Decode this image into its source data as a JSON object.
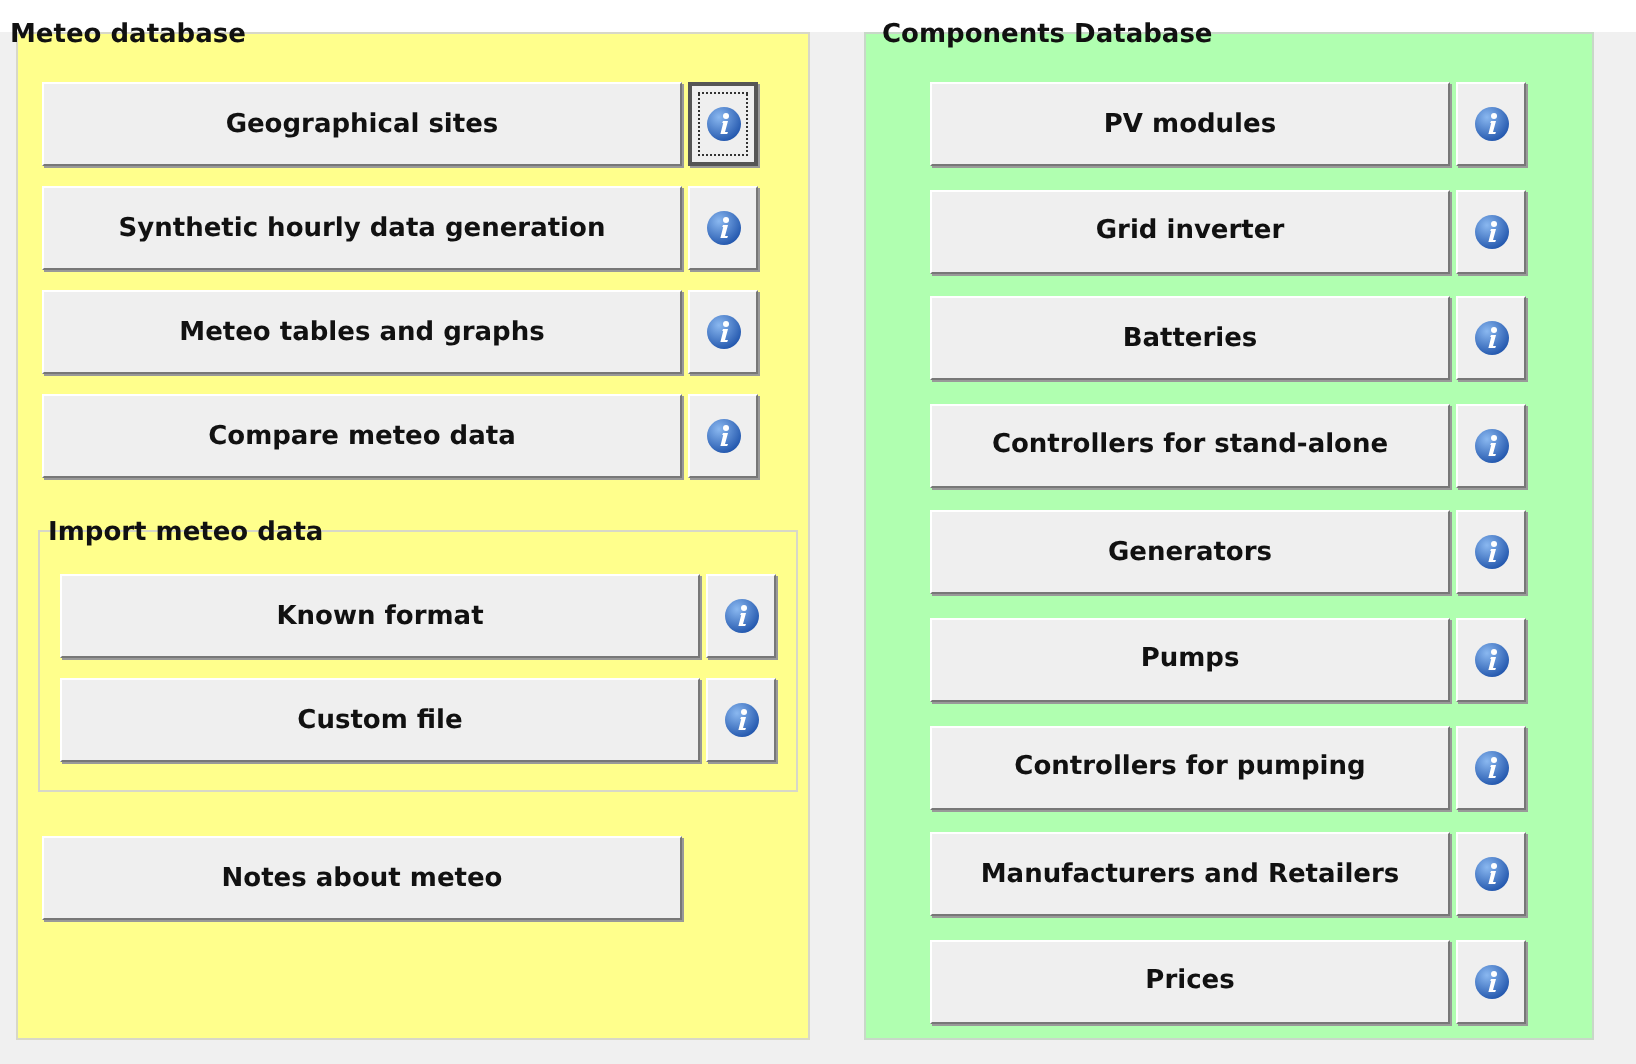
{
  "meteo_database": {
    "title": "Meteo database",
    "buttons": [
      {
        "label": "Geographical sites",
        "info_focused": true
      },
      {
        "label": "Synthetic hourly data generation",
        "info_focused": false
      },
      {
        "label": "Meteo tables and graphs",
        "info_focused": false
      },
      {
        "label": "Compare meteo data",
        "info_focused": false
      }
    ],
    "import_group": {
      "title": "Import meteo data",
      "buttons": [
        {
          "label": "Known format",
          "info_focused": false
        },
        {
          "label": "Custom file",
          "info_focused": false
        }
      ]
    },
    "notes_button": "Notes about meteo"
  },
  "components_database": {
    "title": "Components Database",
    "buttons": [
      {
        "label": "PV modules",
        "info_focused": false
      },
      {
        "label": "Grid inverter",
        "info_focused": false
      },
      {
        "label": "Batteries",
        "info_focused": false
      },
      {
        "label": "Controllers for stand-alone",
        "info_focused": false
      },
      {
        "label": "Generators",
        "info_focused": false
      },
      {
        "label": "Pumps",
        "info_focused": false
      },
      {
        "label": "Controllers for pumping",
        "info_focused": false
      },
      {
        "label": "Manufacturers and Retailers",
        "info_focused": false
      },
      {
        "label": "Prices",
        "info_focused": false
      }
    ]
  }
}
